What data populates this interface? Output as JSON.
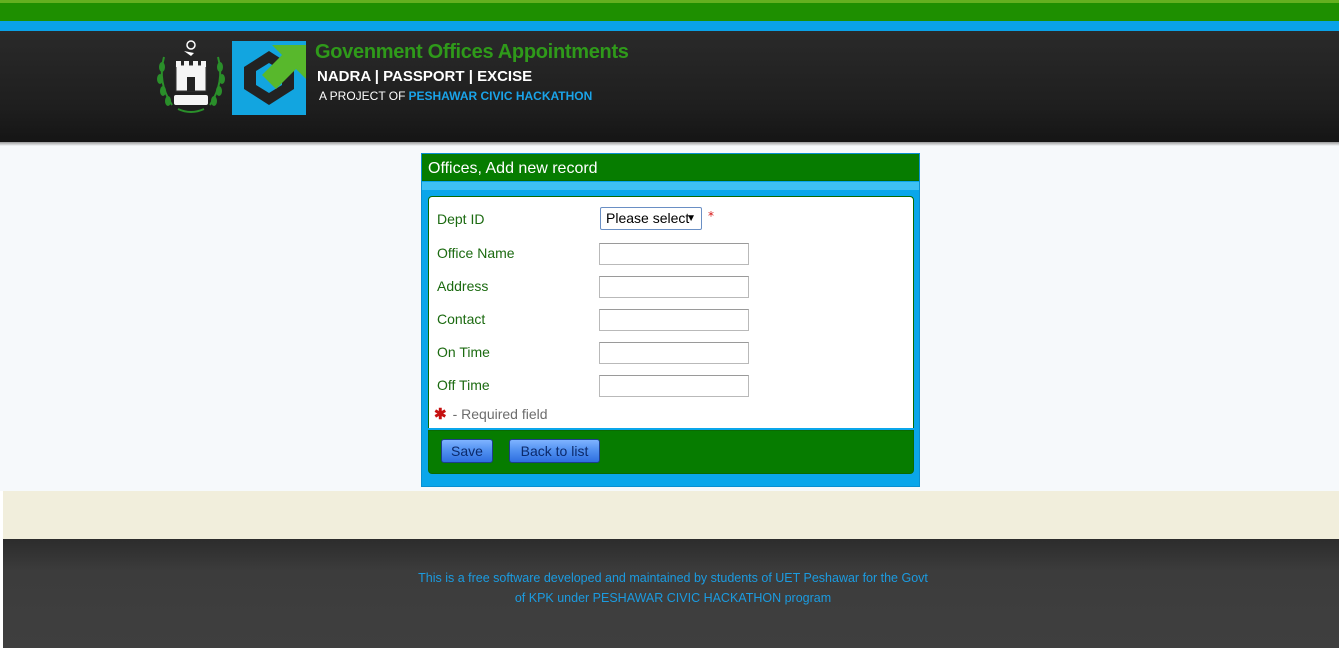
{
  "header": {
    "title": "Govenment Offices Appointments",
    "subtitle": "NADRA | PASSPORT | EXCISE",
    "project_prefix": "A PROJECT OF",
    "project_name": "PESHAWAR CIVIC HACKATHON"
  },
  "panel": {
    "title": "Offices, Add new record"
  },
  "form": {
    "fields": [
      {
        "label": "Dept ID",
        "type": "select",
        "value": "Please select",
        "required": true
      },
      {
        "label": "Office Name",
        "type": "text",
        "value": ""
      },
      {
        "label": "Address",
        "type": "text",
        "value": ""
      },
      {
        "label": "Contact",
        "type": "text",
        "value": ""
      },
      {
        "label": "On Time",
        "type": "text",
        "value": ""
      },
      {
        "label": "Off Time",
        "type": "text",
        "value": ""
      }
    ],
    "required_star": "*",
    "required_note": "- Required field"
  },
  "buttons": {
    "save": "Save",
    "back": "Back to list"
  },
  "footer": {
    "line1": "This is a free software developed and maintained by students of UET Peshawar for the Govt",
    "line2": "of KPK under PESHAWAR CIVIC HACKATHON program"
  },
  "colors": {
    "green": "#067c00",
    "blue": "#0aa6ea",
    "label_green": "#1b6a10",
    "footer_text": "#1b9be0"
  },
  "icons": {
    "emblem": "kpk-government-emblem",
    "logo": "green-blue-cube-logo",
    "dropdown": "caret-down-icon"
  }
}
